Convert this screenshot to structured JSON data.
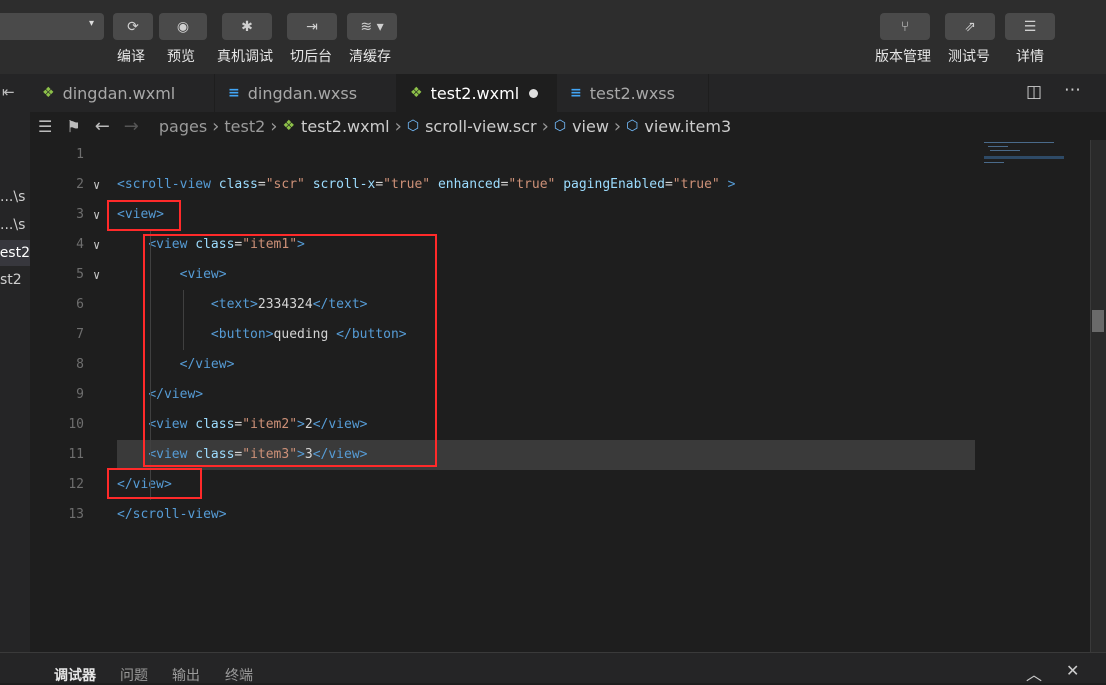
{
  "toolbar": {
    "buttons": [
      {
        "label": "编译",
        "icon": "refresh-icon",
        "glyph": "⟳"
      },
      {
        "label": "预览",
        "icon": "eye-icon",
        "glyph": "◉"
      },
      {
        "label": "真机调试",
        "icon": "bug-icon",
        "glyph": "✱"
      },
      {
        "label": "切后台",
        "icon": "switch-icon",
        "glyph": "⇥"
      },
      {
        "label": "清缓存",
        "icon": "layers-icon",
        "glyph": "≋ ▾"
      }
    ],
    "right_buttons": [
      {
        "label": "版本管理",
        "icon": "branch-icon",
        "glyph": "⑂"
      },
      {
        "label": "测试号",
        "icon": "external-link-icon",
        "glyph": "⇗"
      },
      {
        "label": "详情",
        "icon": "menu-icon",
        "glyph": "☰"
      }
    ]
  },
  "tabs": [
    {
      "label": "dingdan.wxml",
      "icon": "wxml-file-icon",
      "glyph": "❖",
      "color": "#8dc149"
    },
    {
      "label": "dingdan.wxss",
      "icon": "css-file-icon",
      "glyph": "≡",
      "color": "#42a5f5"
    },
    {
      "label": "test2.wxml",
      "icon": "wxml-file-icon",
      "glyph": "❖",
      "color": "#8dc149",
      "modified": true
    },
    {
      "label": "test2.wxss",
      "icon": "css-file-icon",
      "glyph": "≡",
      "color": "#42a5f5"
    }
  ],
  "breadcrumb": [
    "pages",
    "test2",
    "test2.wxml",
    "scroll-view.scr",
    "view",
    "view.item3"
  ],
  "left_panel": {
    "items": [
      "s\\...",
      "s\\...",
      "est2",
      "st2"
    ]
  },
  "code_lines": [
    {
      "n": "1",
      "html": ""
    },
    {
      "n": "2",
      "fold": true,
      "html": "<span class='tag'>&lt;scroll-view</span> <span class='attr'>class</span><span class='txt'>=</span><span class='str'>\"scr\"</span> <span class='attr'>scroll-x</span><span class='txt'>=</span><span class='str'>\"true\"</span> <span class='attr'>enhanced</span><span class='txt'>=</span><span class='str'>\"true\"</span> <span class='attr'>pagingEnabled</span><span class='txt'>=</span><span class='str'>\"true\"</span> <span class='tag'>&gt;</span>"
    },
    {
      "n": "3",
      "fold": true,
      "html": "<span class='tag'>&lt;view&gt;</span>"
    },
    {
      "n": "4",
      "fold": true,
      "html": "    <span class='tag'>&lt;view</span> <span class='attr'>class</span><span class='txt'>=</span><span class='str'>\"item1\"</span><span class='tag'>&gt;</span>"
    },
    {
      "n": "5",
      "fold": true,
      "html": "        <span class='tag'>&lt;view&gt;</span>"
    },
    {
      "n": "6",
      "html": "            <span class='tag'>&lt;text&gt;</span><span class='txt'>2334324</span><span class='tag'>&lt;/text&gt;</span>"
    },
    {
      "n": "7",
      "html": "            <span class='tag'>&lt;button&gt;</span><span class='txt'>queding </span><span class='tag'>&lt;/button&gt;</span>"
    },
    {
      "n": "8",
      "html": "        <span class='tag'>&lt;/view&gt;</span>"
    },
    {
      "n": "9",
      "html": "    <span class='tag'>&lt;/view&gt;</span>"
    },
    {
      "n": "10",
      "html": "    <span class='tag'>&lt;view</span> <span class='attr'>class</span><span class='txt'>=</span><span class='str'>\"item2\"</span><span class='tag'>&gt;</span><span class='txt'>2</span><span class='tag'>&lt;/view&gt;</span>"
    },
    {
      "n": "11",
      "current": true,
      "html": "    <span class='tag'>&lt;view</span> <span class='attr'>class</span><span class='txt'>=</span><span class='str'>\"item3\"</span><span class='tag'>&gt;</span><span class='txt'>3</span><span class='tag'>&lt;/view&gt;</span>"
    },
    {
      "n": "12",
      "html": "<span class='tag'>&lt;/view&gt;</span>"
    },
    {
      "n": "13",
      "html": "<span class='tag'>&lt;/scroll-view&gt;</span>"
    }
  ],
  "bottom_panel": {
    "tabs": [
      "调试器",
      "问题",
      "输出",
      "终端"
    ],
    "active": 0
  }
}
